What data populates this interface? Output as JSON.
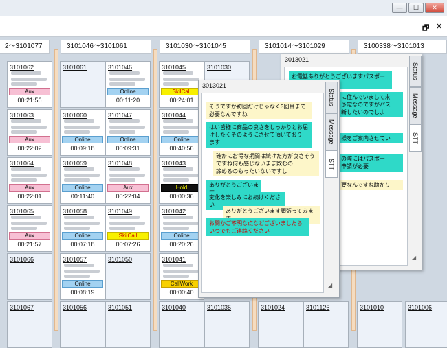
{
  "window": {
    "min": "—",
    "max": "☐",
    "close": "✕"
  },
  "toolbar": {
    "restore": "🗗",
    "close": "✕"
  },
  "groups": [
    "2～3101077",
    "3101046～3101061",
    "3101030～3101045",
    "3101014～3101029",
    "3100338～3101013"
  ],
  "cards": [
    {
      "id": "3101062",
      "status": "Aux",
      "time": "00:21:56"
    },
    {
      "id": "3101061",
      "status": "",
      "time": ""
    },
    {
      "id": "3101046",
      "status": "Online",
      "time": "00:11:20"
    },
    {
      "id": "3101045",
      "status": "SkilCall",
      "time": "00:24:01"
    },
    {
      "id": "3101030",
      "status": "",
      "time": ""
    },
    {
      "id": "3101063",
      "status": "Aux",
      "time": "00:22:02"
    },
    {
      "id": "3101060",
      "status": "Online",
      "time": "00:09:18"
    },
    {
      "id": "3101047",
      "status": "Online",
      "time": "00:09:31"
    },
    {
      "id": "3101044",
      "status": "Online",
      "time": "00:40:56"
    },
    {
      "id": "3101064",
      "status": "Aux",
      "time": "00:22:01"
    },
    {
      "id": "3101059",
      "status": "Online",
      "time": "00:11:40"
    },
    {
      "id": "3101048",
      "status": "Aux",
      "time": "00:22:04"
    },
    {
      "id": "3101043",
      "status": "Hold",
      "time": "00:00:36"
    },
    {
      "id": "3101065",
      "status": "Aux",
      "time": "00:21:57"
    },
    {
      "id": "3101058",
      "status": "Online",
      "time": "00:07:18"
    },
    {
      "id": "3101049",
      "status": "SkilCall",
      "time": "00:07:26"
    },
    {
      "id": "3101042",
      "status": "Online",
      "time": "00:20:26"
    },
    {
      "id": "3101066",
      "status": "",
      "time": ""
    },
    {
      "id": "3101057",
      "status": "Online",
      "time": "00:08:19"
    },
    {
      "id": "3101050",
      "status": "",
      "time": ""
    },
    {
      "id": "3101041",
      "status": "CallWork",
      "time": "00:00:40"
    },
    {
      "id": "3101067",
      "status": "",
      "time": ""
    },
    {
      "id": "3101056",
      "status": "",
      "time": ""
    },
    {
      "id": "3101051",
      "status": "",
      "time": ""
    },
    {
      "id": "3101040",
      "status": "",
      "time": ""
    },
    {
      "id": "3101035",
      "status": "",
      "time": ""
    },
    {
      "id": "3101024",
      "status": "",
      "time": ""
    },
    {
      "id": "3101126",
      "status": "",
      "time": ""
    },
    {
      "id": "3101010",
      "status": "",
      "time": ""
    },
    {
      "id": "3101006",
      "status": "",
      "time": ""
    }
  ],
  "popup_back": {
    "id": "3013021",
    "tabs": [
      "Status",
      "Message",
      "STT"
    ],
    "messages": [
      "お電話ありがとうございますパスポート",
      "に住んでいまして来\n予定なのですがパス\n新したいのでしよ",
      "様をご案内させてい",
      "の際にはパスポー\n申請が必要",
      "要なんですね助かり"
    ]
  },
  "popup_front": {
    "id": "3013021",
    "tabs": [
      "Status",
      "Message",
      "STT"
    ],
    "messages": [
      "そうですか初回だけじゃなく3回目まで\n必要なんですね",
      "はい皆様に商品の良さをしっかりとお届\nけしたくそのようにさせて頂いており\nます",
      "確かにお得な期間は続けた方が良さそう\nですね何も感じないまま飲むの\n諦めるのもったいないですし",
      "ありがとうございます",
      "変化を楽しみにお続けください",
      "ありがとうございます頑張ってみます",
      "お問かご不明な点などございましたら\nいつでもご連絡ください"
    ]
  }
}
